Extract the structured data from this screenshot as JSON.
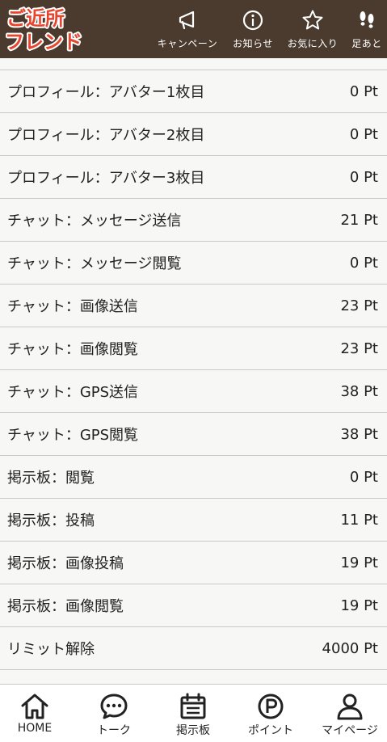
{
  "header": {
    "logo_text": [
      "ご近所",
      "フレンド"
    ],
    "nav": [
      {
        "label": "キャンペーン",
        "icon": "megaphone-icon"
      },
      {
        "label": "お知らせ",
        "icon": "info-icon"
      },
      {
        "label": "お気に入り",
        "icon": "star-icon"
      },
      {
        "label": "足あと",
        "icon": "footprints-icon"
      }
    ]
  },
  "points_table": [
    {
      "name": "プロフィール：アバター1枚目",
      "points": "0 Pt"
    },
    {
      "name": "プロフィール：アバター2枚目",
      "points": "0 Pt"
    },
    {
      "name": "プロフィール：アバター3枚目",
      "points": "0 Pt"
    },
    {
      "name": "チャット：メッセージ送信",
      "points": "21 Pt"
    },
    {
      "name": "チャット：メッセージ閲覧",
      "points": "0 Pt"
    },
    {
      "name": "チャット：画像送信",
      "points": "23 Pt"
    },
    {
      "name": "チャット：画像閲覧",
      "points": "23 Pt"
    },
    {
      "name": "チャット：GPS送信",
      "points": "38 Pt"
    },
    {
      "name": "チャット：GPS閲覧",
      "points": "38 Pt"
    },
    {
      "name": "掲示板：閲覧",
      "points": "0 Pt"
    },
    {
      "name": "掲示板：投稿",
      "points": "11 Pt"
    },
    {
      "name": "掲示板：画像投稿",
      "points": "19 Pt"
    },
    {
      "name": "掲示板：画像閲覧",
      "points": "19 Pt"
    },
    {
      "name": "リミット解除",
      "points": "4000 Pt"
    }
  ],
  "footer": {
    "nav": [
      {
        "label": "HOME",
        "icon": "home-icon"
      },
      {
        "label": "トーク",
        "icon": "chat-bubble-icon"
      },
      {
        "label": "掲示板",
        "icon": "calendar-icon"
      },
      {
        "label": "ポイント",
        "icon": "point-p-icon"
      },
      {
        "label": "マイページ",
        "icon": "user-icon"
      }
    ]
  },
  "colors": {
    "header_bg": "#4a3b2e",
    "logo_red": "#e8452f",
    "logo_outline": "#ffffff",
    "row_divider": "#c9c9c9"
  }
}
